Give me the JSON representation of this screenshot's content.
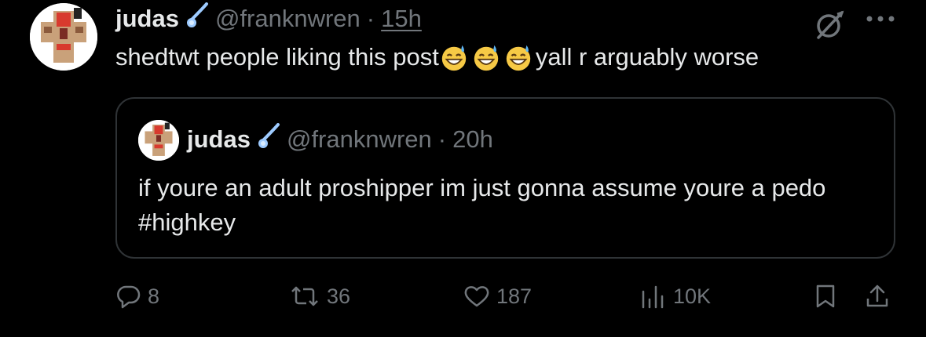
{
  "tweet": {
    "author": {
      "name": "judas",
      "handle": "@franknwren",
      "separator": "·",
      "time": "15h"
    },
    "text_before": "shedtwt people liking this post",
    "emojis": [
      "grinning-face-with-sweat",
      "grinning-face-with-sweat",
      "grinning-face-with-sweat"
    ],
    "text_after": "yall r arguably worse",
    "quote": {
      "author": {
        "name": "judas",
        "handle": "@franknwren",
        "separator": "·",
        "time": "20h"
      },
      "text": "if youre an adult proshipper im just gonna assume youre a pedo #highkey"
    },
    "stats": {
      "replies": "8",
      "reposts": "36",
      "likes": "187",
      "views": "10K"
    }
  },
  "icons": {
    "badge": "comet-icon",
    "grok": "grok-slash-icon",
    "more": "more-dots-icon",
    "reply": "reply-icon",
    "repost": "repost-icon",
    "like": "heart-icon",
    "views": "views-icon",
    "bookmark": "bookmark-icon",
    "share": "share-icon"
  },
  "colors": {
    "background": "#000000",
    "text": "#e7e9ea",
    "muted": "#71767b",
    "border": "#2f3336",
    "badge": "#9ecbff"
  }
}
